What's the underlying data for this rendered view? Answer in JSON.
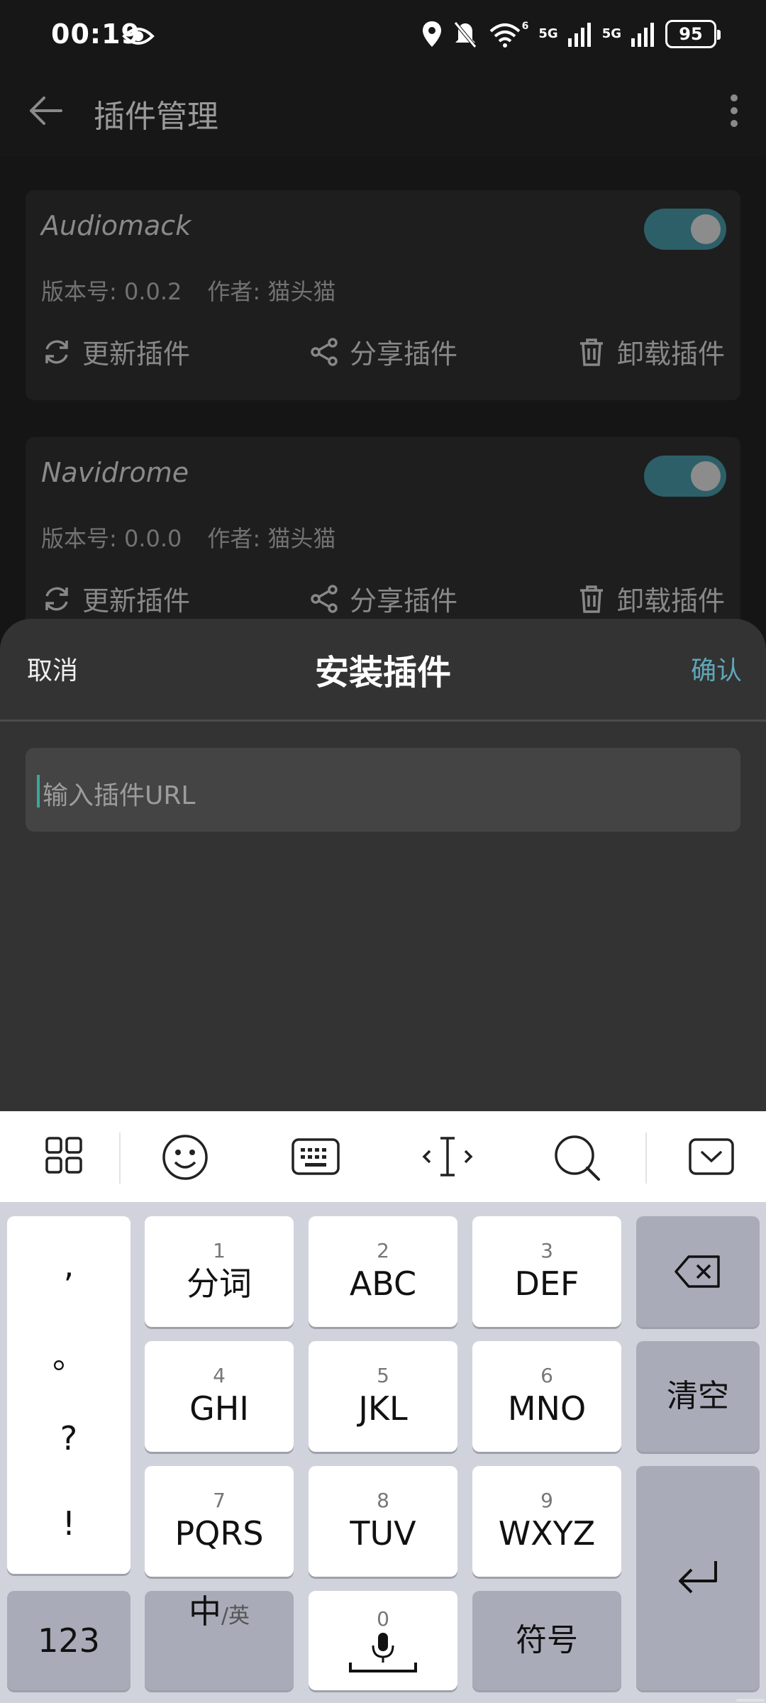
{
  "status_bar": {
    "time": "00:19",
    "network_1": "5G",
    "network_2": "5G",
    "wifi_badge": "6",
    "battery": "95"
  },
  "app_bar": {
    "title": "插件管理"
  },
  "plugins": [
    {
      "name": "Audiomack",
      "version": "版本号: 0.0.2",
      "author": "作者: 猫头猫",
      "enabled": true,
      "actions": {
        "update": "更新插件",
        "share": "分享插件",
        "uninstall": "卸载插件"
      }
    },
    {
      "name": "Navidrome",
      "version": "版本号: 0.0.0",
      "author": "作者: 猫头猫",
      "enabled": true,
      "actions": {
        "update": "更新插件",
        "share": "分享插件",
        "uninstall": "卸载插件"
      }
    }
  ],
  "sheet": {
    "cancel": "取消",
    "title": "安装插件",
    "confirm": "确认",
    "input_placeholder": "输入插件URL"
  },
  "keyboard": {
    "punctuation": [
      ",",
      "。",
      "?",
      "!"
    ],
    "keys": [
      {
        "num": "1",
        "label": "分词"
      },
      {
        "num": "2",
        "label": "ABC"
      },
      {
        "num": "3",
        "label": "DEF"
      },
      {
        "num": "4",
        "label": "GHI"
      },
      {
        "num": "5",
        "label": "JKL"
      },
      {
        "num": "6",
        "label": "MNO"
      },
      {
        "num": "7",
        "label": "PQRS"
      },
      {
        "num": "8",
        "label": "TUV"
      },
      {
        "num": "9",
        "label": "WXYZ"
      }
    ],
    "clear": "清空",
    "num_switch": "123",
    "lang_main": "中",
    "lang_sub": "/英",
    "space_num": "0",
    "symbols": "符号"
  },
  "colors": {
    "accent": "#5ea7b8",
    "toggle_track": "#2d5f68",
    "sheet_bg": "#333333"
  }
}
